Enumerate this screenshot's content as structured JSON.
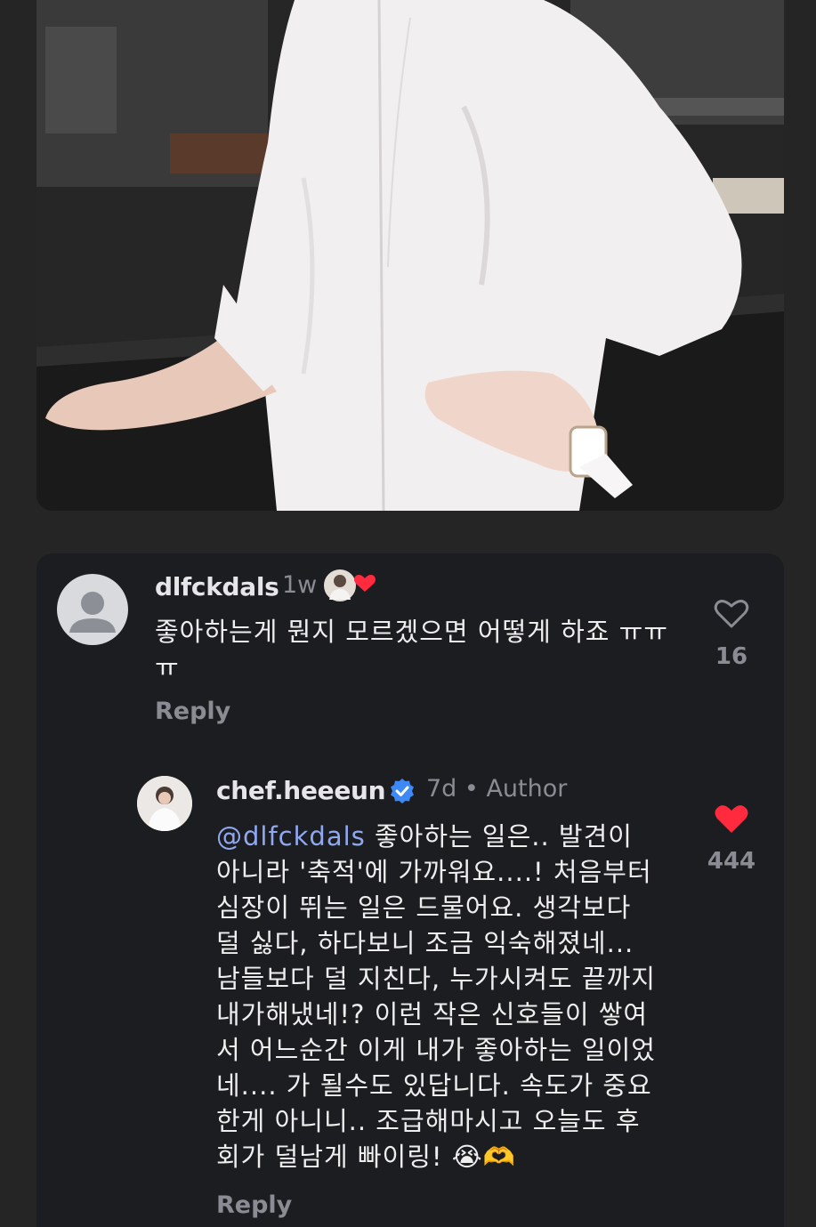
{
  "comments": [
    {
      "username": "dlfckdals",
      "time": "1w",
      "text": "좋아하는게 뭔지 모르겠으면 어떻게 하죠 ㅠㅠㅠ",
      "reply_label": "Reply",
      "like_count": "16",
      "liked_by_author": true
    }
  ],
  "reply": {
    "username": "chef.heeeun",
    "verified": true,
    "time": "7d",
    "separator": "•",
    "author_badge": "Author",
    "mention": "@dlfckdals",
    "text_lines": [
      " 좋아하는 일은.. 발견이",
      "아니라 '축적'에 가까워요....! 처음부터",
      "심장이 뛰는 일은 드물어요. 생각보다",
      "덜 싫다, 하다보니 조금 익숙해졌네...",
      "남들보다 덜 지친다, 누가시켜도 끝까지",
      "내가해냈네!? 이런 작은 신호들이 쌓여",
      "서 어느순간 이게 내가 좋아하는 일이었",
      "네.... 가 될수도 있답니다. 속도가 중요",
      "한게 아니니.. 조급해마시고 오늘도 후",
      "회가 덜남게 빠이링!"
    ],
    "emoji": [
      "😭",
      "🫶"
    ],
    "reply_label": "Reply",
    "like_count": "444",
    "liked": true
  },
  "icons": {
    "heart_outline": "heart-outline-icon",
    "heart_filled": "heart-filled-icon",
    "verified": "verified-badge-icon",
    "avatar_placeholder": "person-icon"
  },
  "colors": {
    "background": "#252525",
    "card": "#1c1d21",
    "like_red": "#ff2a3d",
    "verified_blue": "#3d8af7",
    "mention_blue": "#8fa8f0",
    "muted": "#8a8c93"
  }
}
